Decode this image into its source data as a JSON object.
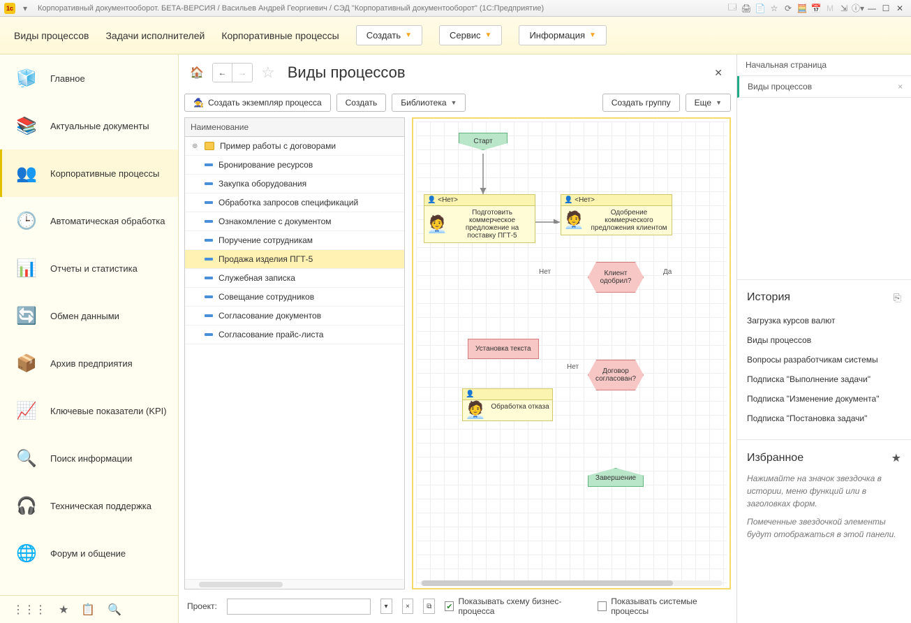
{
  "titlebar": {
    "title": "Корпоративный документооборот. БЕТА-ВЕРСИЯ / Васильев Андрей Георгиевич / СЭД \"Корпоративный документооборот\"  (1С:Предприятие)"
  },
  "topmenu": {
    "link1": "Виды процессов",
    "link2": "Задачи исполнителей",
    "link3": "Корпоративные процессы",
    "btn_create": "Создать",
    "btn_service": "Сервис",
    "btn_info": "Информация"
  },
  "leftnav": {
    "items": [
      {
        "label": "Главное"
      },
      {
        "label": "Актуальные документы"
      },
      {
        "label": "Корпоративные процессы"
      },
      {
        "label": "Автоматическая обработка"
      },
      {
        "label": "Отчеты и статистика"
      },
      {
        "label": "Обмен данными"
      },
      {
        "label": "Архив предприятия"
      },
      {
        "label": "Ключевые показатели (KPI)"
      },
      {
        "label": "Поиск информации"
      },
      {
        "label": "Техническая поддержка"
      },
      {
        "label": "Форум и общение"
      }
    ],
    "active_index": 2
  },
  "page": {
    "title": "Виды процессов"
  },
  "toolbar": {
    "btn_instance": "Создать экземпляр процесса",
    "btn_create": "Создать",
    "btn_library": "Библиотека",
    "btn_group": "Создать группу",
    "btn_more": "Еще"
  },
  "tree": {
    "header": "Наименование",
    "folder": "Пример работы с договорами",
    "items": [
      "Бронирование ресурсов",
      "Закупка оборудования",
      "Обработка запросов спецификаций",
      "Ознакомление с документом",
      "Поручение сотрудникам",
      "Продажа изделия ПГТ-5",
      "Служебная записка",
      "Совещание сотрудников",
      "Согласование документов",
      "Согласование прайс-листа"
    ],
    "selected_index": 5
  },
  "diagram": {
    "start": "Старт",
    "none": "<Нет>",
    "task1": "Подготовить коммерческое предложение на поставку ПГТ-5",
    "task2": "Одобрение коммерческого предложения клиентом",
    "dec1": "Клиент одобрил?",
    "box1": "Установка текста",
    "dec2": "Договор согласован?",
    "task3": "Обработка отказа",
    "end": "Завершение",
    "yes": "Да",
    "no": "Нет",
    "no2": "Нет"
  },
  "bottom": {
    "project_label": "Проект:",
    "project_value": "",
    "chk1_label": "Показывать схему бизнес-процесса",
    "chk1_checked": true,
    "chk2_label": "Показывать системые процессы",
    "chk2_checked": false
  },
  "rightbar": {
    "tab_home": "Начальная страница",
    "tab_active": "Виды процессов",
    "history_title": "История",
    "history": [
      "Загрузка курсов валют",
      "Виды процессов",
      "Вопросы разработчикам системы",
      "Подписка \"Выполнение задачи\"",
      "Подписка \"Изменение документа\"",
      "Подписка \"Постановка задачи\""
    ],
    "fav_title": "Избранное",
    "fav_hint1": "Нажимайте на значок звездочка в истории, меню функций или в заголовках форм.",
    "fav_hint2": "Помеченные звездочкой элементы будут отображаться в этой панели."
  }
}
